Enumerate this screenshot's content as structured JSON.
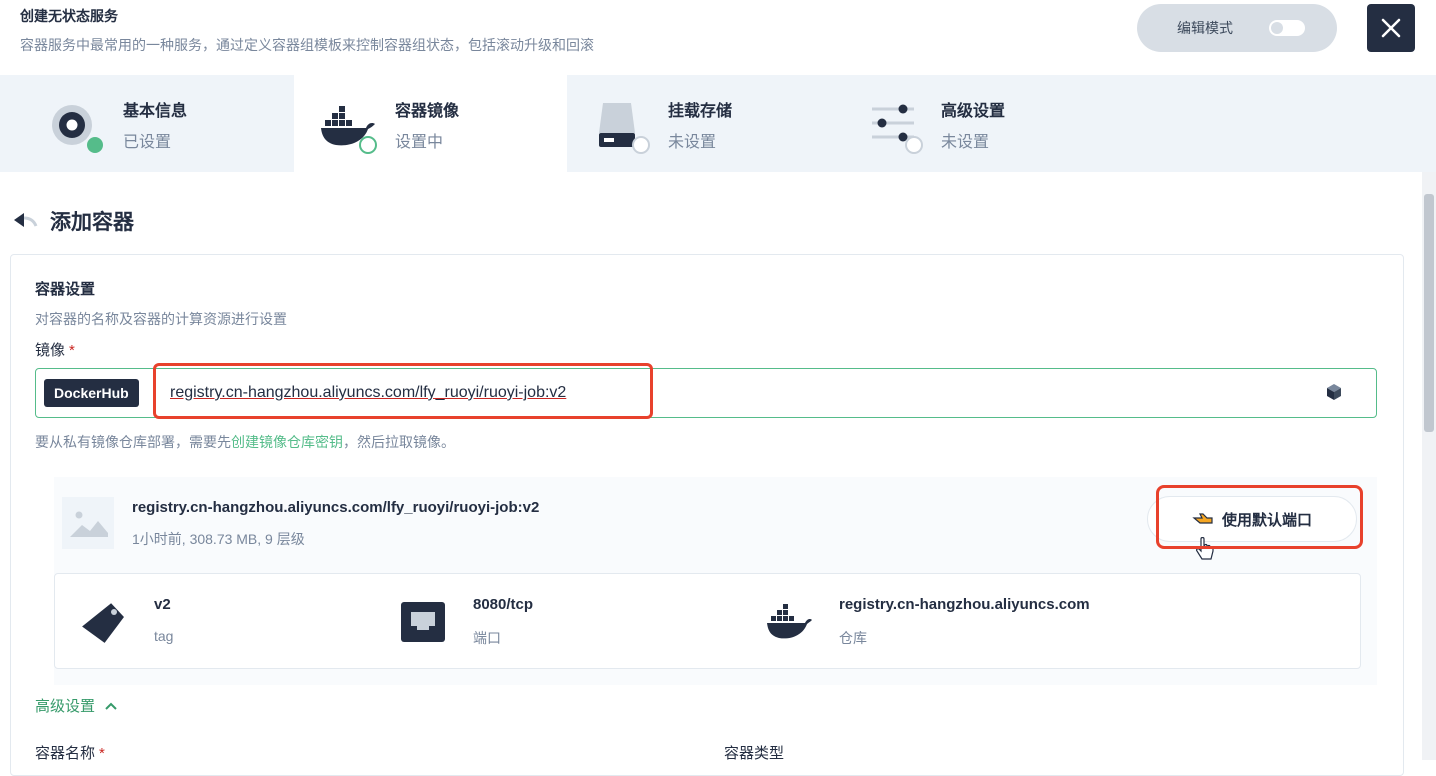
{
  "header": {
    "title": "创建无状态服务",
    "description": "容器服务中最常用的一种服务，通过定义容器组模板来控制容器组状态，包括滚动升级和回滚",
    "edit_mode_label": "编辑模式"
  },
  "steps": [
    {
      "title": "基本信息",
      "status": "已设置",
      "icon": "settings-circle-icon"
    },
    {
      "title": "容器镜像",
      "status": "设置中",
      "icon": "docker-whale-icon"
    },
    {
      "title": "挂载存储",
      "status": "未设置",
      "icon": "storage-disk-icon"
    },
    {
      "title": "高级设置",
      "status": "未设置",
      "icon": "sliders-icon"
    }
  ],
  "page": {
    "back_title": "添加容器"
  },
  "container_settings": {
    "title": "容器设置",
    "description": "对容器的名称及容器的计算资源进行设置",
    "image_label": "镜像",
    "required_mark": "*",
    "registry_tag": "DockerHub",
    "image_value": "registry.cn-hangzhou.aliyuncs.com/lfy_ruoyi/ruoyi-job:v2",
    "hint_prefix": "要从私有镜像仓库部署，需要先",
    "hint_link": "创建镜像仓库密钥",
    "hint_suffix": "，然后拉取镜像。"
  },
  "image_card": {
    "name": "registry.cn-hangzhou.aliyuncs.com/lfy_ruoyi/ruoyi-job:v2",
    "meta": "1小时前, 308.73 MB, 9 层级",
    "use_default_port_label": "使用默认端口",
    "info": [
      {
        "value": "v2",
        "label": "tag",
        "icon": "tag-icon"
      },
      {
        "value": "8080/tcp",
        "label": "端口",
        "icon": "ethernet-port-icon"
      },
      {
        "value": "registry.cn-hangzhou.aliyuncs.com",
        "label": "仓库",
        "icon": "docker-whale-icon"
      }
    ]
  },
  "advanced": {
    "toggle_label": "高级设置",
    "container_name_label": "容器名称",
    "container_name_required": "*",
    "container_type_label": "容器类型"
  },
  "colors": {
    "primary_dark": "#242e42",
    "accent_green": "#55bc8a",
    "highlight_red": "#e8412c"
  }
}
